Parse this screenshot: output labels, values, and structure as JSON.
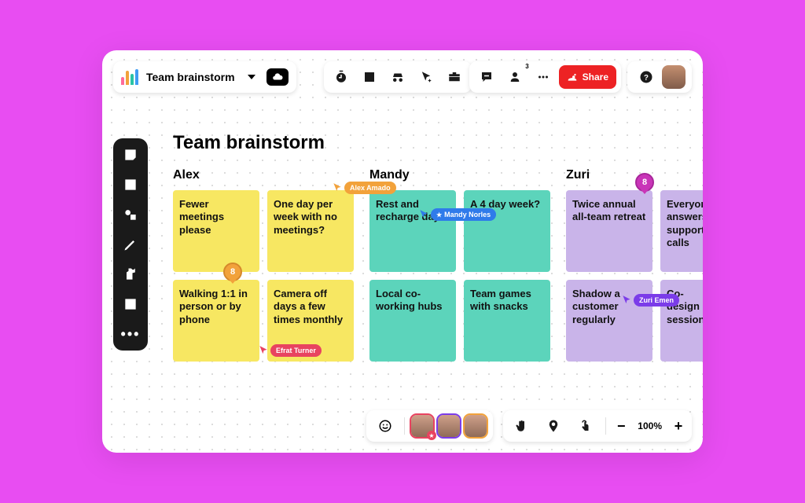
{
  "header": {
    "board_name": "Team brainstorm",
    "share_label": "Share",
    "participant_count": "3"
  },
  "canvas": {
    "title": "Team brainstorm",
    "columns": [
      {
        "name": "Alex",
        "color": "yellow",
        "notes": [
          "Fewer meetings please",
          "One day per week with no meetings?",
          "Walking 1:1 in person or by phone",
          "Camera off days a few times monthly"
        ]
      },
      {
        "name": "Mandy",
        "color": "teal",
        "notes": [
          "Rest and recharge days",
          "A 4 day week?",
          "Local co-working hubs",
          "Team games with snacks"
        ]
      },
      {
        "name": "Zuri",
        "color": "purple",
        "notes": [
          "Twice annual all-team retreat",
          "Everyone answers support calls",
          "Shadow a customer regularly",
          "Co-design sessions"
        ]
      }
    ]
  },
  "cursors": {
    "alex": "Alex Amado",
    "mandy": "Mandy Norles",
    "efrat": "Efrat Turner",
    "zuri": "Zuri Emen"
  },
  "votes": {
    "pin1": "8",
    "pin2": "8"
  },
  "footer": {
    "zoom": "100%"
  }
}
